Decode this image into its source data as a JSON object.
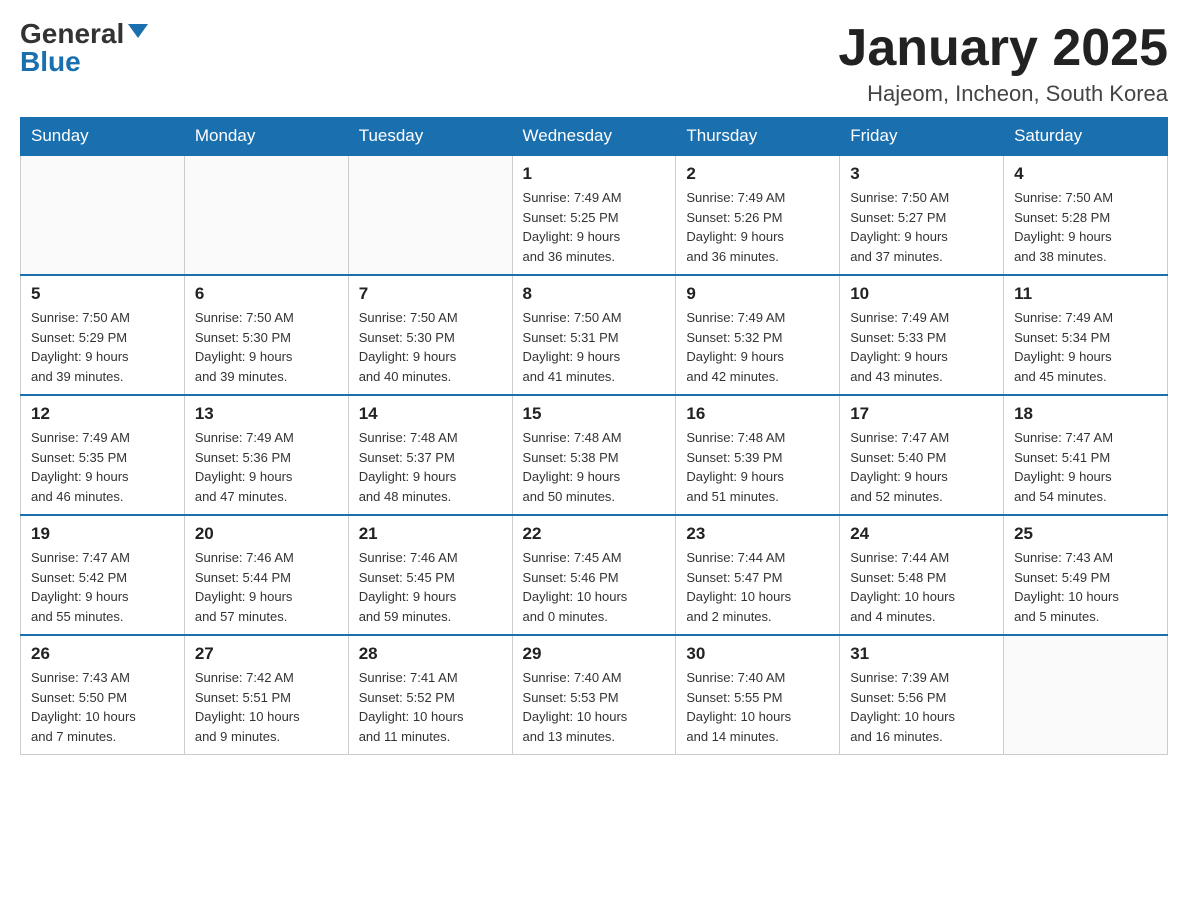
{
  "logo": {
    "general": "General",
    "blue": "Blue"
  },
  "title": "January 2025",
  "location": "Hajeom, Incheon, South Korea",
  "weekdays": [
    "Sunday",
    "Monday",
    "Tuesday",
    "Wednesday",
    "Thursday",
    "Friday",
    "Saturday"
  ],
  "weeks": [
    [
      {
        "day": "",
        "info": ""
      },
      {
        "day": "",
        "info": ""
      },
      {
        "day": "",
        "info": ""
      },
      {
        "day": "1",
        "info": "Sunrise: 7:49 AM\nSunset: 5:25 PM\nDaylight: 9 hours\nand 36 minutes."
      },
      {
        "day": "2",
        "info": "Sunrise: 7:49 AM\nSunset: 5:26 PM\nDaylight: 9 hours\nand 36 minutes."
      },
      {
        "day": "3",
        "info": "Sunrise: 7:50 AM\nSunset: 5:27 PM\nDaylight: 9 hours\nand 37 minutes."
      },
      {
        "day": "4",
        "info": "Sunrise: 7:50 AM\nSunset: 5:28 PM\nDaylight: 9 hours\nand 38 minutes."
      }
    ],
    [
      {
        "day": "5",
        "info": "Sunrise: 7:50 AM\nSunset: 5:29 PM\nDaylight: 9 hours\nand 39 minutes."
      },
      {
        "day": "6",
        "info": "Sunrise: 7:50 AM\nSunset: 5:30 PM\nDaylight: 9 hours\nand 39 minutes."
      },
      {
        "day": "7",
        "info": "Sunrise: 7:50 AM\nSunset: 5:30 PM\nDaylight: 9 hours\nand 40 minutes."
      },
      {
        "day": "8",
        "info": "Sunrise: 7:50 AM\nSunset: 5:31 PM\nDaylight: 9 hours\nand 41 minutes."
      },
      {
        "day": "9",
        "info": "Sunrise: 7:49 AM\nSunset: 5:32 PM\nDaylight: 9 hours\nand 42 minutes."
      },
      {
        "day": "10",
        "info": "Sunrise: 7:49 AM\nSunset: 5:33 PM\nDaylight: 9 hours\nand 43 minutes."
      },
      {
        "day": "11",
        "info": "Sunrise: 7:49 AM\nSunset: 5:34 PM\nDaylight: 9 hours\nand 45 minutes."
      }
    ],
    [
      {
        "day": "12",
        "info": "Sunrise: 7:49 AM\nSunset: 5:35 PM\nDaylight: 9 hours\nand 46 minutes."
      },
      {
        "day": "13",
        "info": "Sunrise: 7:49 AM\nSunset: 5:36 PM\nDaylight: 9 hours\nand 47 minutes."
      },
      {
        "day": "14",
        "info": "Sunrise: 7:48 AM\nSunset: 5:37 PM\nDaylight: 9 hours\nand 48 minutes."
      },
      {
        "day": "15",
        "info": "Sunrise: 7:48 AM\nSunset: 5:38 PM\nDaylight: 9 hours\nand 50 minutes."
      },
      {
        "day": "16",
        "info": "Sunrise: 7:48 AM\nSunset: 5:39 PM\nDaylight: 9 hours\nand 51 minutes."
      },
      {
        "day": "17",
        "info": "Sunrise: 7:47 AM\nSunset: 5:40 PM\nDaylight: 9 hours\nand 52 minutes."
      },
      {
        "day": "18",
        "info": "Sunrise: 7:47 AM\nSunset: 5:41 PM\nDaylight: 9 hours\nand 54 minutes."
      }
    ],
    [
      {
        "day": "19",
        "info": "Sunrise: 7:47 AM\nSunset: 5:42 PM\nDaylight: 9 hours\nand 55 minutes."
      },
      {
        "day": "20",
        "info": "Sunrise: 7:46 AM\nSunset: 5:44 PM\nDaylight: 9 hours\nand 57 minutes."
      },
      {
        "day": "21",
        "info": "Sunrise: 7:46 AM\nSunset: 5:45 PM\nDaylight: 9 hours\nand 59 minutes."
      },
      {
        "day": "22",
        "info": "Sunrise: 7:45 AM\nSunset: 5:46 PM\nDaylight: 10 hours\nand 0 minutes."
      },
      {
        "day": "23",
        "info": "Sunrise: 7:44 AM\nSunset: 5:47 PM\nDaylight: 10 hours\nand 2 minutes."
      },
      {
        "day": "24",
        "info": "Sunrise: 7:44 AM\nSunset: 5:48 PM\nDaylight: 10 hours\nand 4 minutes."
      },
      {
        "day": "25",
        "info": "Sunrise: 7:43 AM\nSunset: 5:49 PM\nDaylight: 10 hours\nand 5 minutes."
      }
    ],
    [
      {
        "day": "26",
        "info": "Sunrise: 7:43 AM\nSunset: 5:50 PM\nDaylight: 10 hours\nand 7 minutes."
      },
      {
        "day": "27",
        "info": "Sunrise: 7:42 AM\nSunset: 5:51 PM\nDaylight: 10 hours\nand 9 minutes."
      },
      {
        "day": "28",
        "info": "Sunrise: 7:41 AM\nSunset: 5:52 PM\nDaylight: 10 hours\nand 11 minutes."
      },
      {
        "day": "29",
        "info": "Sunrise: 7:40 AM\nSunset: 5:53 PM\nDaylight: 10 hours\nand 13 minutes."
      },
      {
        "day": "30",
        "info": "Sunrise: 7:40 AM\nSunset: 5:55 PM\nDaylight: 10 hours\nand 14 minutes."
      },
      {
        "day": "31",
        "info": "Sunrise: 7:39 AM\nSunset: 5:56 PM\nDaylight: 10 hours\nand 16 minutes."
      },
      {
        "day": "",
        "info": ""
      }
    ]
  ]
}
